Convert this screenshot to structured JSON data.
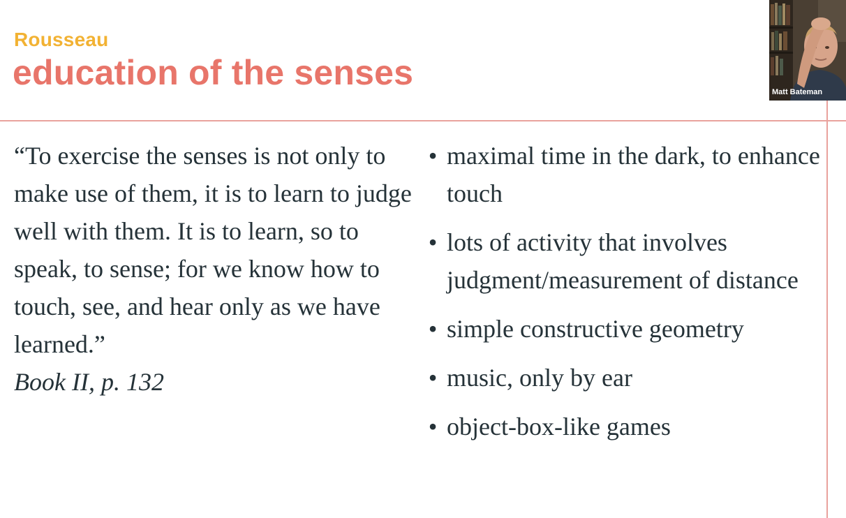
{
  "slide": {
    "kicker": "Rousseau",
    "title": "education of the senses",
    "quote": {
      "text": "“To exercise the senses is not only to make use of them, it is to learn to judge well with them. It is to learn, so to speak, to sense; for we know how to touch, see, and hear only as we have learned.”",
      "citation": "Book II, p. 132"
    },
    "bullets": [
      "maximal time in the dark, to enhance touch",
      "lots of activity that involves judgment/measurement of distance",
      "simple constructive geometry",
      "music, only by ear",
      "object-box-like games"
    ],
    "bullet_glyph": "•"
  },
  "webcam": {
    "participant_name": "Matt Bateman"
  },
  "colors": {
    "kicker": "#f2b233",
    "title": "#e8756a",
    "body_text": "#253238",
    "rules": "#e9a29d"
  },
  "icons": {
    "bullet": "bullet-dot-icon"
  }
}
